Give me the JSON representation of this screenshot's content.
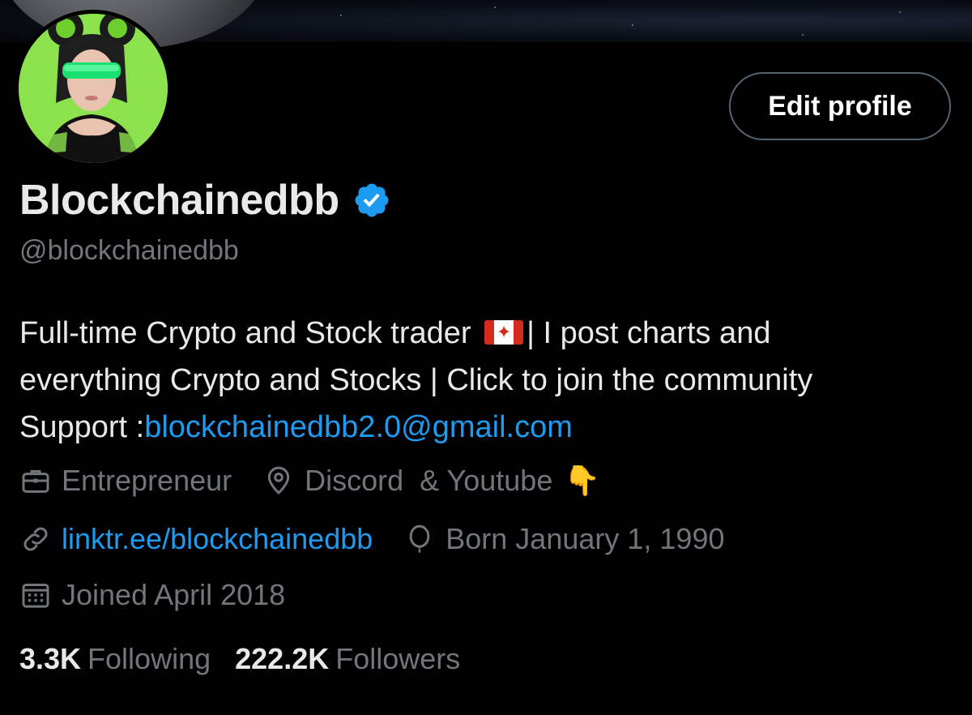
{
  "profile": {
    "edit_button": "Edit profile",
    "display_name": "Blockchainedbb",
    "handle": "@blockchainedbb",
    "verified": true
  },
  "bio": {
    "line1_start": "Full-time Crypto and Stock trader ",
    "line1_end": "| I post charts and",
    "line2": "everything Crypto and Stocks | Click to join the community",
    "support_label": "Support :",
    "support_email": "blockchainedbb2.0@gmail.com"
  },
  "meta": {
    "profession": "Entrepreneur",
    "location": "Discord  & Youtube",
    "location_emoji": "👇",
    "website": "linktr.ee/blockchainedbb",
    "birthday": "Born January 1, 1990",
    "joined": "Joined April 2018"
  },
  "stats": {
    "following_count": "3.3K",
    "following_label": "Following",
    "followers_count": "222.2K",
    "followers_label": "Followers"
  },
  "colors": {
    "background": "#000000",
    "text_primary": "#e7e9ea",
    "text_secondary": "#71767b",
    "link": "#1d9bf0",
    "verified_badge": "#1d9bf0",
    "avatar_bg": "#8be24c"
  },
  "icons": {
    "verified": "verified-badge-icon",
    "profession": "briefcase-icon",
    "location": "location-pin-icon",
    "website": "link-icon",
    "birthday": "balloon-icon",
    "joined": "calendar-icon"
  }
}
